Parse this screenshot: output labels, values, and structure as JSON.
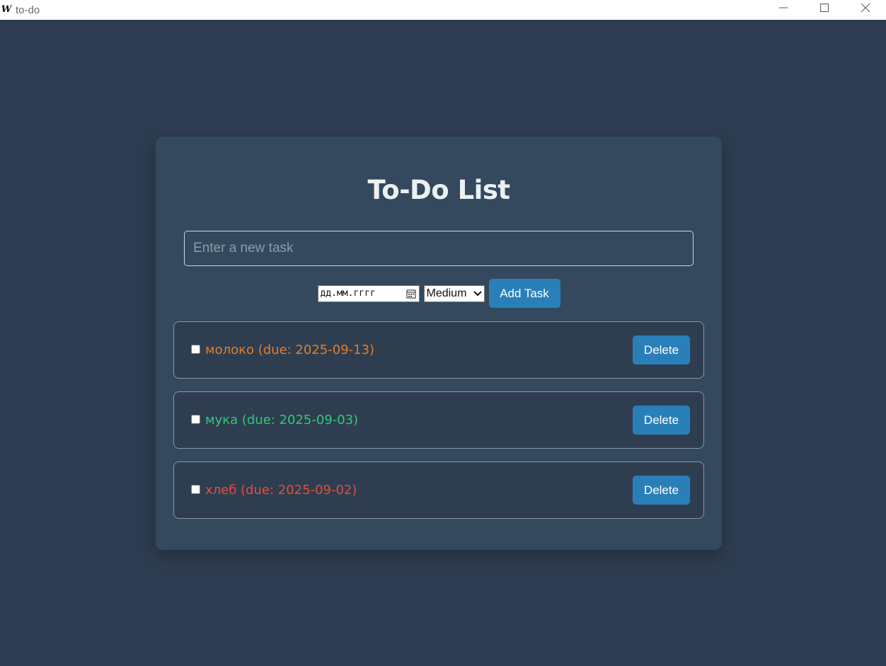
{
  "window": {
    "app_icon_glyph": "W",
    "title": "to-do",
    "icons": [
      "minimize-icon",
      "maximize-icon",
      "close-icon"
    ]
  },
  "app": {
    "title": "To-Do List",
    "new_task": {
      "value": "",
      "placeholder": "Enter a new task"
    },
    "due_date": {
      "placeholder": "дд.мм.гггг"
    },
    "priority": {
      "selected": "Medium"
    },
    "add_label": "Add Task",
    "tasks": [
      {
        "label": "молоко (due: 2025-09-13)",
        "color": "#e67e22",
        "done": false,
        "delete_label": "Delete"
      },
      {
        "label": "мука (due: 2025-09-03)",
        "color": "#2ecc71",
        "done": false,
        "delete_label": "Delete"
      },
      {
        "label": "хлеб (due: 2025-09-02)",
        "color": "#e74c3c",
        "done": false,
        "delete_label": "Delete"
      }
    ]
  },
  "colors": {
    "background": "#2d3c50",
    "card": "#34495e",
    "accent": "#2980b9",
    "title_text": "#ecf0f1"
  }
}
